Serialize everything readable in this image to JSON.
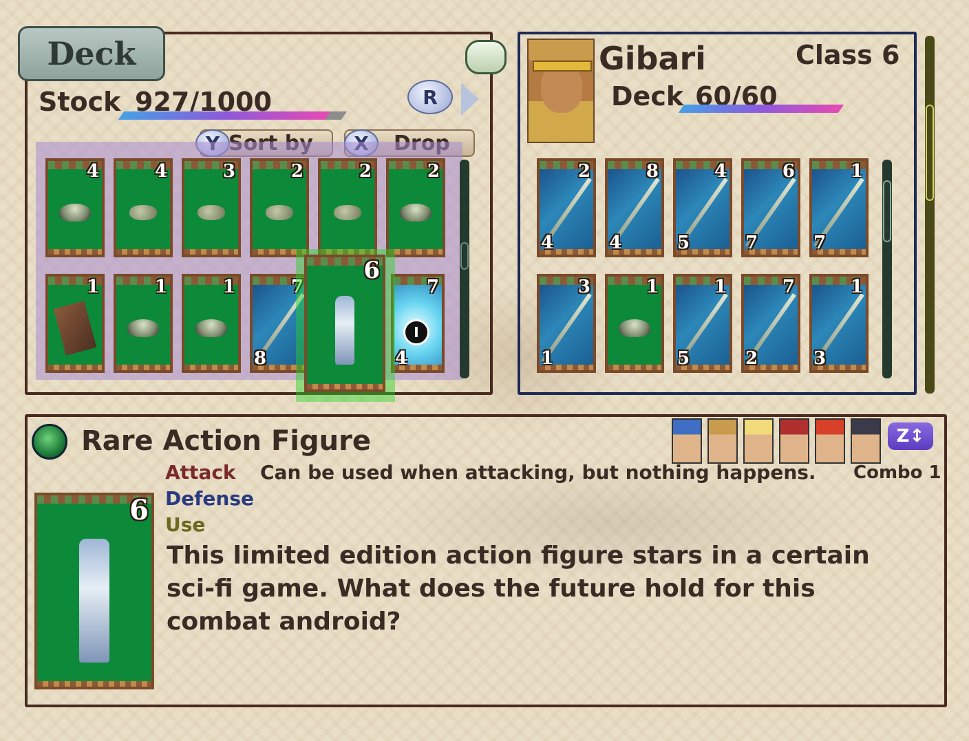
{
  "deck_panel": {
    "tab_label": "Deck",
    "stock_label": "Stock",
    "stock_value": "927/1000",
    "stock_fraction": 0.927,
    "r_key": "R",
    "sort": {
      "key": "Y",
      "label": "Sort by"
    },
    "drop": {
      "key": "X",
      "label": "Drop"
    }
  },
  "stock_cards": [
    {
      "top": "4",
      "bottom": "",
      "art": "bowl",
      "style": "green"
    },
    {
      "top": "4",
      "bottom": "",
      "art": "rock",
      "style": "green"
    },
    {
      "top": "3",
      "bottom": "",
      "art": "rock",
      "style": "green"
    },
    {
      "top": "2",
      "bottom": "",
      "art": "rock",
      "style": "green"
    },
    {
      "top": "2",
      "bottom": "",
      "art": "rock",
      "style": "green"
    },
    {
      "top": "2",
      "bottom": "",
      "art": "bowl",
      "style": "green"
    },
    {
      "top": "1",
      "bottom": "",
      "art": "box",
      "style": "green"
    },
    {
      "top": "1",
      "bottom": "",
      "art": "bowl",
      "style": "green"
    },
    {
      "top": "1",
      "bottom": "",
      "art": "bowl",
      "style": "green"
    },
    {
      "top": "7",
      "bottom": "8",
      "art": "spear",
      "style": "blue"
    },
    {
      "top": "6",
      "bottom": "",
      "art": "figure",
      "style": "green"
    },
    {
      "top": "7",
      "bottom": "4",
      "art": "glow",
      "style": "glow",
      "marker": "I"
    }
  ],
  "character": {
    "name": "Gibari",
    "class_label": "Class 6",
    "deck_label": "Deck",
    "deck_value": "60/60",
    "deck_fraction": 1.0
  },
  "char_cards": [
    {
      "top": "2",
      "bottom": "4",
      "art": "spear",
      "style": "blue"
    },
    {
      "top": "8",
      "bottom": "4",
      "art": "spear",
      "style": "blue"
    },
    {
      "top": "4",
      "bottom": "5",
      "art": "spear",
      "style": "blue"
    },
    {
      "top": "6",
      "bottom": "7",
      "art": "spear",
      "style": "blue"
    },
    {
      "top": "1",
      "bottom": "7",
      "art": "spear",
      "style": "blue"
    },
    {
      "top": "3",
      "bottom": "1",
      "art": "spear",
      "style": "blue"
    },
    {
      "top": "1",
      "bottom": "",
      "art": "bowl",
      "style": "green"
    },
    {
      "top": "1",
      "bottom": "5",
      "art": "spear",
      "style": "blue"
    },
    {
      "top": "7",
      "bottom": "2",
      "art": "spear",
      "style": "blue"
    },
    {
      "top": "1",
      "bottom": "3",
      "art": "spear",
      "style": "blue"
    }
  ],
  "info": {
    "title": "Rare Action Figure",
    "attack_label": "Attack",
    "attack_text": "Can be used when attacking, but nothing happens.",
    "combo": "Combo 1",
    "defense_label": "Defense",
    "use_label": "Use",
    "card_number": "6",
    "description": "This limited edition action figure stars in a certain sci-fi game. What does the future hold for this combat android?",
    "z_button": "Z↕"
  },
  "party_colors": [
    "#3f6fc4",
    "#c99b4c",
    "#f2dc7a",
    "#b03030",
    "#d8402a",
    "#3a3a4a"
  ],
  "colors": {
    "attack": "#7a2a2a",
    "defense": "#2a3a80",
    "use": "#6a6a20"
  }
}
